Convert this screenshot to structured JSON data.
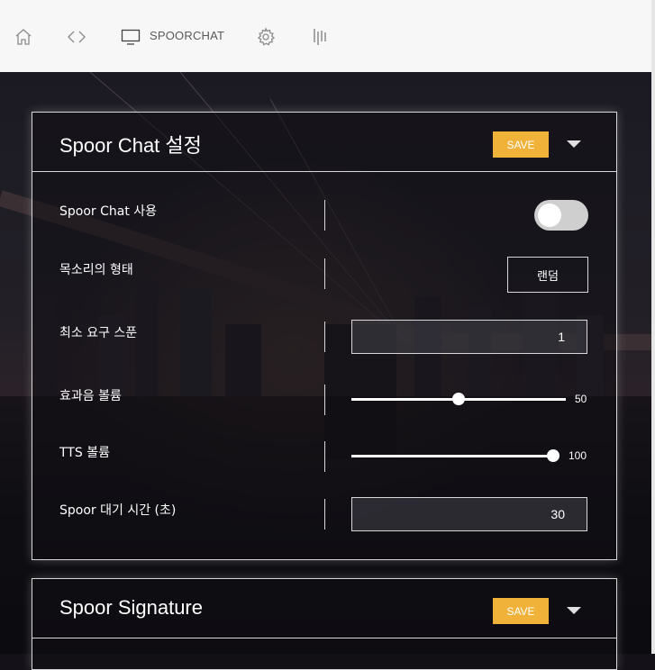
{
  "nav": {
    "items": [
      {
        "icon": "home-icon"
      },
      {
        "icon": "code-icon"
      },
      {
        "icon": "monitor-icon",
        "label": "SPOORCHAT"
      },
      {
        "icon": "gear-icon"
      },
      {
        "icon": "bars-icon"
      }
    ]
  },
  "panels": [
    {
      "title": "Spoor Chat 설정",
      "save_label": "SAVE",
      "rows": [
        {
          "label": "Spoor Chat 사용",
          "type": "toggle",
          "value": false
        },
        {
          "label": "목소리의 형태",
          "type": "select",
          "value": "랜덤"
        },
        {
          "label": "최소 요구 스푼",
          "type": "number",
          "value": "1"
        },
        {
          "label": "효과음 볼륨",
          "type": "slider",
          "value": 50,
          "max": 100,
          "display": "50"
        },
        {
          "label": "TTS 볼륨",
          "type": "slider",
          "value": 100,
          "max": 100,
          "display": "100"
        },
        {
          "label": "Spoor 대기 시간 (초)",
          "type": "number",
          "value": "30"
        }
      ]
    },
    {
      "title": "Spoor Signature",
      "save_label": "SAVE"
    }
  ],
  "colors": {
    "accent": "#f1b23a",
    "topbar": "#f7f7f7",
    "panel_border": "#d8d8d8"
  }
}
